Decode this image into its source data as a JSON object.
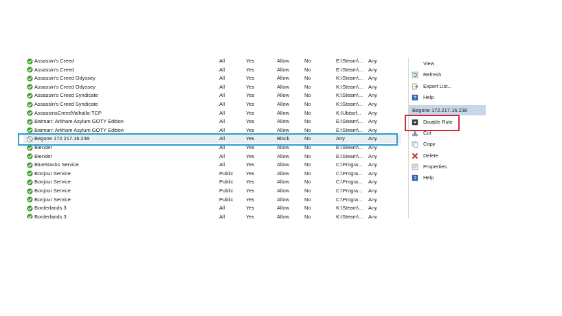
{
  "rules": [
    {
      "name": "Assassin's Creed",
      "profile": "All",
      "enabled": "Yes",
      "action": "Allow",
      "override": "No",
      "program": "E:\\Steam\\...",
      "address": "Any",
      "status": "allow"
    },
    {
      "name": "Assassin's Creed",
      "profile": "All",
      "enabled": "Yes",
      "action": "Allow",
      "override": "No",
      "program": "E:\\Steam\\...",
      "address": "Any",
      "status": "allow"
    },
    {
      "name": "Assassin's Creed Odyssey",
      "profile": "All",
      "enabled": "Yes",
      "action": "Allow",
      "override": "No",
      "program": "K:\\Steam\\...",
      "address": "Any",
      "status": "allow"
    },
    {
      "name": "Assassin's Creed Odyssey",
      "profile": "All",
      "enabled": "Yes",
      "action": "Allow",
      "override": "No",
      "program": "K:\\Steam\\...",
      "address": "Any",
      "status": "allow"
    },
    {
      "name": "Assassin's Creed Syndicate",
      "profile": "All",
      "enabled": "Yes",
      "action": "Allow",
      "override": "No",
      "program": "K:\\Steam\\...",
      "address": "Any",
      "status": "allow"
    },
    {
      "name": "Assassin's Creed Syndicate",
      "profile": "All",
      "enabled": "Yes",
      "action": "Allow",
      "override": "No",
      "program": "K:\\Steam\\...",
      "address": "Any",
      "status": "allow"
    },
    {
      "name": "AssassinsCreedValhalla-TCP",
      "profile": "All",
      "enabled": "Yes",
      "action": "Allow",
      "override": "No",
      "program": "K:\\Ubisof...",
      "address": "Any",
      "status": "allow"
    },
    {
      "name": "Batman: Arkham Asylum GOTY Edition",
      "profile": "All",
      "enabled": "Yes",
      "action": "Allow",
      "override": "No",
      "program": "E:\\Steam\\...",
      "address": "Any",
      "status": "allow"
    },
    {
      "name": "Batman: Arkham Asylum GOTY Edition",
      "profile": "All",
      "enabled": "Yes",
      "action": "Allow",
      "override": "No",
      "program": "E:\\Steam\\...",
      "address": "Any",
      "status": "allow"
    },
    {
      "name": "Begone 172.217.16.238",
      "profile": "All",
      "enabled": "Yes",
      "action": "Block",
      "override": "No",
      "program": "Any",
      "address": "Any",
      "status": "block",
      "selected": true
    },
    {
      "name": "Blender",
      "profile": "All",
      "enabled": "Yes",
      "action": "Allow",
      "override": "No",
      "program": "E:\\Steam\\...",
      "address": "Any",
      "status": "allow"
    },
    {
      "name": "Blender",
      "profile": "All",
      "enabled": "Yes",
      "action": "Allow",
      "override": "No",
      "program": "E:\\Steam\\...",
      "address": "Any",
      "status": "allow"
    },
    {
      "name": "BlueStacks Service",
      "profile": "All",
      "enabled": "Yes",
      "action": "Allow",
      "override": "No",
      "program": "C:\\Progra...",
      "address": "Any",
      "status": "allow"
    },
    {
      "name": "Bonjour Service",
      "profile": "Public",
      "enabled": "Yes",
      "action": "Allow",
      "override": "No",
      "program": "C:\\Progra...",
      "address": "Any",
      "status": "allow"
    },
    {
      "name": "Bonjour Service",
      "profile": "Public",
      "enabled": "Yes",
      "action": "Allow",
      "override": "No",
      "program": "C:\\Progra...",
      "address": "Any",
      "status": "allow"
    },
    {
      "name": "Bonjour Service",
      "profile": "Public",
      "enabled": "Yes",
      "action": "Allow",
      "override": "No",
      "program": "C:\\Progra...",
      "address": "Any",
      "status": "allow"
    },
    {
      "name": "Bonjour Service",
      "profile": "Public",
      "enabled": "Yes",
      "action": "Allow",
      "override": "No",
      "program": "C:\\Progra...",
      "address": "Any",
      "status": "allow"
    },
    {
      "name": "Borderlands 3",
      "profile": "All",
      "enabled": "Yes",
      "action": "Allow",
      "override": "No",
      "program": "K:\\Steam\\...",
      "address": "Any",
      "status": "allow"
    },
    {
      "name": "Borderlands 3",
      "profile": "All",
      "enabled": "Yes",
      "action": "Allow",
      "override": "No",
      "program": "K:\\Steam\\...",
      "address": "Any",
      "status": "allow"
    }
  ],
  "actions_top": [
    {
      "label": "View",
      "icon": "view-icon"
    },
    {
      "label": "Refresh",
      "icon": "refresh-icon"
    },
    {
      "label": "Export List...",
      "icon": "export-list-icon"
    },
    {
      "label": "Help",
      "icon": "help-icon"
    }
  ],
  "selected_rule_header": "Begone 172.217.16.238",
  "actions_rule": [
    {
      "label": "Disable Rule",
      "icon": "disable-rule-icon"
    },
    {
      "label": "Cut",
      "icon": "cut-icon"
    },
    {
      "label": "Copy",
      "icon": "copy-icon"
    },
    {
      "label": "Delete",
      "icon": "delete-icon"
    },
    {
      "label": "Properties",
      "icon": "properties-icon"
    },
    {
      "label": "Help",
      "icon": "help-icon"
    }
  ],
  "colors": {
    "allow": "#3f9b2d",
    "block": "#7a7a7a",
    "selection_outline": "#26a0c8",
    "highlight_box": "#d2283b",
    "section_header": "#c8d6e9"
  }
}
